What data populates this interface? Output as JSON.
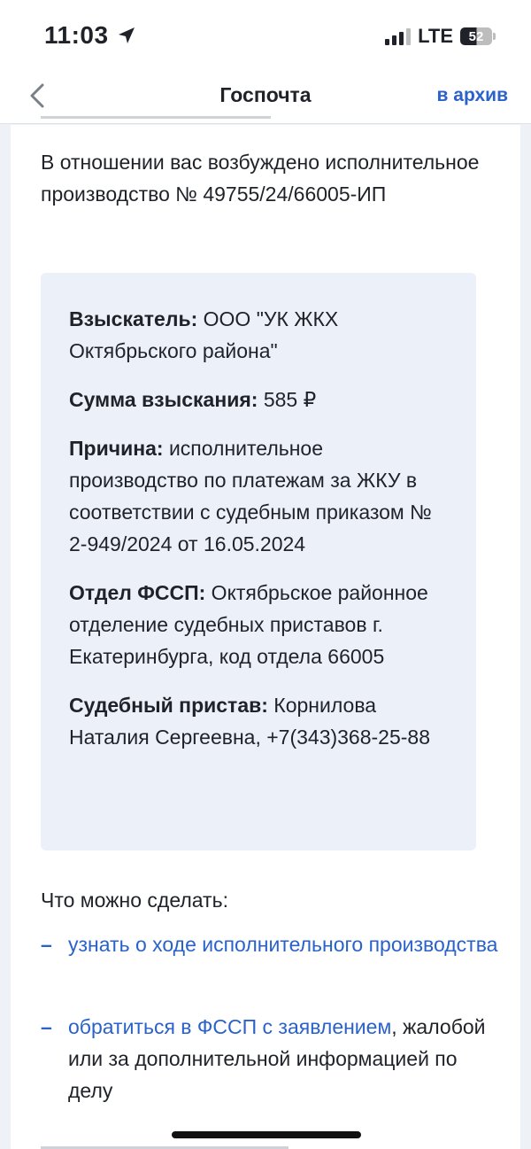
{
  "status_bar": {
    "time": "11:03",
    "network": "LTE",
    "battery": "52"
  },
  "nav": {
    "title": "Госпочта",
    "archive": "в архив"
  },
  "message": {
    "intro": "В отношении вас возбуждено исполнительное производство № 49755/24/66005-ИП",
    "details": [
      {
        "label": "Взыскатель:",
        "value": " ООО \"УК ЖКХ Октябрьского района\""
      },
      {
        "label": "Сумма взыскания:",
        "value": " 585 ₽"
      },
      {
        "label": "Причина:",
        "value": " исполнительное производство по платежам за ЖКУ в соответствии с судебным приказом № 2-949/2024 от 16.05.2024"
      },
      {
        "label": "Отдел ФССП:",
        "value": " Октябрьское районное отделение судебных приставов г. Екатеринбурга, код отдела 66005"
      },
      {
        "label": "Судебный пристав:",
        "value": " Корнилова Наталия Сергеевна, +7(343)368-25-88"
      }
    ],
    "actions_title": "Что можно сделать:",
    "actions": [
      {
        "dash": "–",
        "link": "узнать о ходе исполнительного производства",
        "rest": ""
      },
      {
        "dash": "–",
        "link": "обратиться в ФССП с заявлением",
        "rest": ", жалобой или за дополнительной информацией по делу"
      }
    ]
  }
}
